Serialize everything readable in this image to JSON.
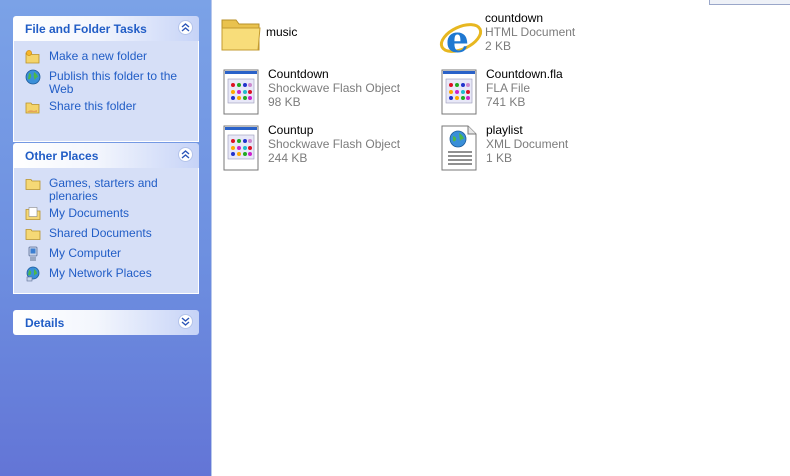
{
  "sidebar": {
    "file_tasks": {
      "title": "File and Folder Tasks",
      "items": [
        {
          "label": "Make a new folder",
          "icon": "new-folder-icon"
        },
        {
          "label": "Publish this folder to the Web",
          "icon": "globe-icon"
        },
        {
          "label": "Share this folder",
          "icon": "share-folder-icon"
        }
      ]
    },
    "other_places": {
      "title": "Other Places",
      "items": [
        {
          "label": "Games, starters and plenaries",
          "icon": "folder-icon"
        },
        {
          "label": "My Documents",
          "icon": "my-documents-icon"
        },
        {
          "label": "Shared Documents",
          "icon": "folder-icon"
        },
        {
          "label": "My Computer",
          "icon": "my-computer-icon"
        },
        {
          "label": "My Network Places",
          "icon": "network-places-icon"
        }
      ]
    },
    "details": {
      "title": "Details"
    }
  },
  "files": [
    {
      "name": "music",
      "type": "",
      "size": "",
      "icon": "folder-icon"
    },
    {
      "name": "countdown",
      "type": "HTML Document",
      "size": "2 KB",
      "icon": "ie-html-icon"
    },
    {
      "name": "Countdown",
      "type": "Shockwave Flash Object",
      "size": "98 KB",
      "icon": "flash-object-icon"
    },
    {
      "name": "Countdown.fla",
      "type": "FLA File",
      "size": "741 KB",
      "icon": "fla-file-icon"
    },
    {
      "name": "Countup",
      "type": "Shockwave Flash Object",
      "size": "244 KB",
      "icon": "flash-object-icon"
    },
    {
      "name": "playlist",
      "type": "XML Document",
      "size": "1 KB",
      "icon": "xml-document-icon"
    }
  ],
  "colors": {
    "link": "#215dc6",
    "sidebar_top": "#7ba2e7",
    "sidebar_bottom": "#6375d6",
    "panel_body": "#d6dff7",
    "meta_text": "#7c7c7c"
  }
}
